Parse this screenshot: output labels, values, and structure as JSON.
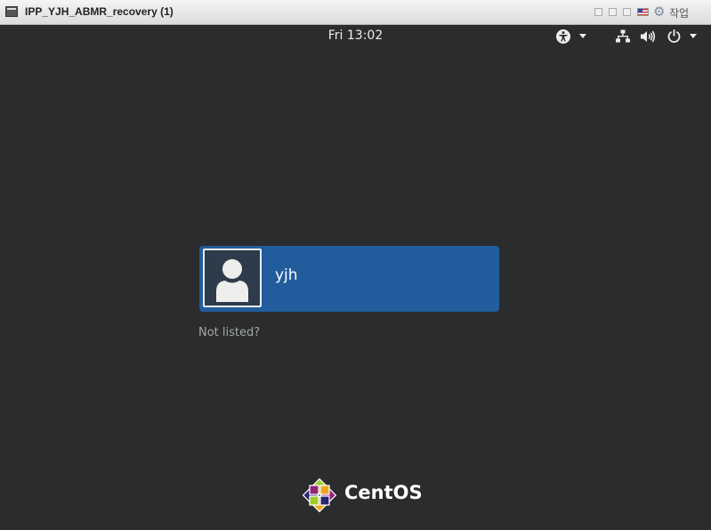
{
  "window": {
    "title": "IPP_YJH_ABMR_recovery (1)",
    "task_label": "작업"
  },
  "topbar": {
    "clock": "Fri 13:02",
    "icons": [
      "accessibility-icon",
      "network-icon",
      "volume-icon",
      "power-icon"
    ]
  },
  "login": {
    "users": [
      {
        "name": "yjh",
        "selected": true
      }
    ],
    "not_listed_label": "Not listed?"
  },
  "branding": {
    "name": "CentOS"
  },
  "colors": {
    "background": "#2a2c2e",
    "selected_user": "#215d9c",
    "text": "#eeeeec",
    "muted_text": "#a7a9a6"
  }
}
